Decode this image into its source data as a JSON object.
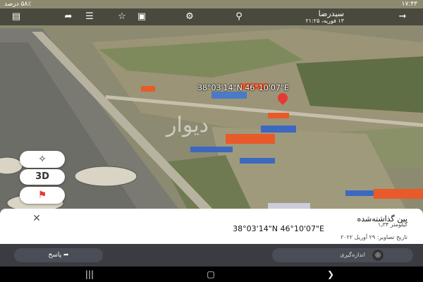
{
  "status_bar": {
    "time": "۱۷:۴۳",
    "battery": "۵۸٪ درصد"
  },
  "top_bar": {
    "title": "سیدرضا",
    "subtitle": "۱۳ فوریه، ۲۱:۲۵",
    "icons": [
      "back-icon",
      "share-icon",
      "star-icon",
      "layers-icon"
    ]
  },
  "map": {
    "coords_overlay": "38°03'14\"N 46°10'07\"E",
    "pin_color": "#e53935",
    "watermark": "دیوار"
  },
  "controls": {
    "btn_3d": "3D",
    "compass_icon": "compass-icon",
    "pin_icon": "pin-icon"
  },
  "sheet": {
    "title": "پین گذاشته‌شده",
    "coords": "38°03'14\"N 46°10'07\"E",
    "distance": "کیلومتر ۱٫۳۴",
    "date": "تاریخ تصاویر: ۲۹ آوریل ۲۰۲۲",
    "close_icon": "close-icon"
  },
  "buttons": {
    "reply": "پاسخ",
    "measure": "اندازه‌گیری"
  },
  "nav": {
    "icons": [
      "recents-icon",
      "home-icon",
      "back-icon"
    ]
  }
}
